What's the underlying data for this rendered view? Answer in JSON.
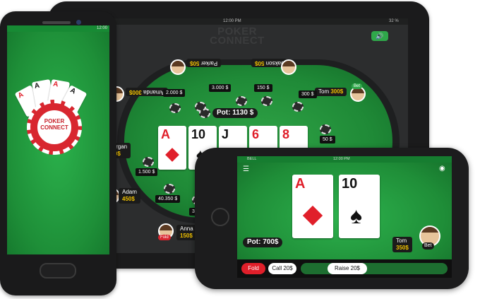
{
  "tablet": {
    "status_time": "12:00 PM",
    "status_battery": "32 %",
    "logo_line1": "POKER",
    "logo_line2": "CONNECT",
    "pot_label": "Pot: 1130 $",
    "community_cards": [
      {
        "rank": "A",
        "suit": "diamonds",
        "color": "red"
      },
      {
        "rank": "10",
        "suit": "spades",
        "color": "black"
      },
      {
        "rank": "J",
        "suit": "spades",
        "color": "black"
      },
      {
        "rank": "6",
        "suit": "diamonds",
        "color": "red"
      },
      {
        "rank": "8",
        "suit": "diamonds",
        "color": "red"
      }
    ],
    "players": {
      "parker": {
        "name": "Parker",
        "amount": "50$"
      },
      "jakson": {
        "name": "Jakson",
        "amount": "50$"
      },
      "amanda": {
        "name": "Amanda",
        "amount": "300$"
      },
      "tom": {
        "name": "Tom",
        "amount": "300$",
        "badge": "Bet"
      },
      "morgan": {
        "name": "Morgan",
        "amount": "200$"
      },
      "adam": {
        "name": "Adam",
        "amount": "450$"
      },
      "anna": {
        "name": "Anna",
        "amount": "150$",
        "badge": "Fold"
      }
    },
    "bets": {
      "b1": "2.000 $",
      "b2": "3.000 $",
      "b3": "150 $",
      "b4": "300 $",
      "b5": "300 $",
      "b6": "1.500 $",
      "b7": "40.350 $",
      "b8": "300 $",
      "b9": "50 $"
    }
  },
  "android": {
    "status_time": "12:00",
    "logo_line1": "POKER",
    "logo_line2": "CONNECT",
    "cards": [
      "A",
      "A",
      "A",
      "A"
    ]
  },
  "iphone": {
    "status_carrier": "BELL",
    "status_time": "12:00 PM",
    "hole_cards": [
      {
        "rank": "A",
        "suit": "diamonds",
        "color": "red"
      },
      {
        "rank": "10",
        "suit": "spades",
        "color": "black"
      }
    ],
    "pot_label": "Pot: 700$",
    "opponent": {
      "name": "Tom",
      "amount": "350$",
      "badge": "Bet"
    },
    "controls": {
      "fold": "Fold",
      "call": "Call 20$",
      "raise": "Raise 20$"
    }
  },
  "colors": {
    "felt": "#1f8a37",
    "accent_red": "#e01f2a",
    "chip_gold": "#f0c000",
    "volume_green": "#2fa84a"
  }
}
